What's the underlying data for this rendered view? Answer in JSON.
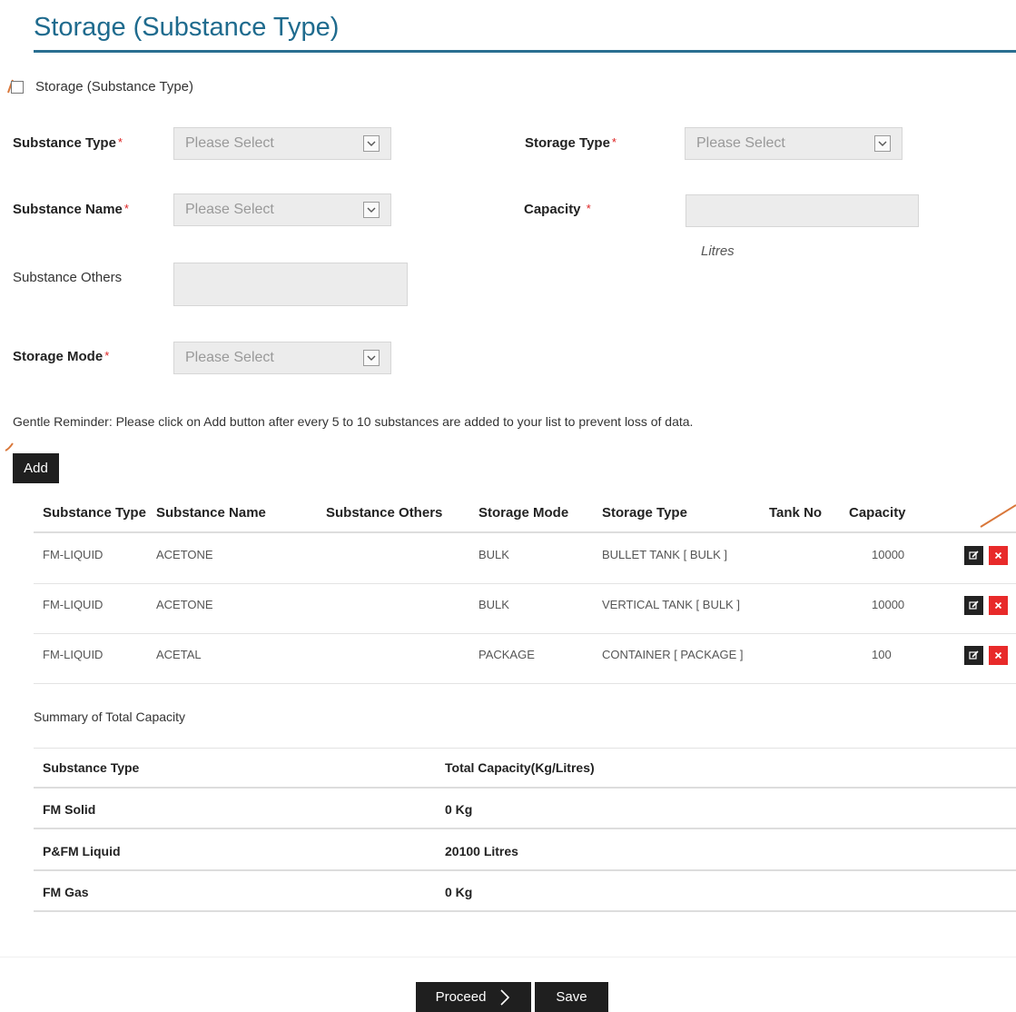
{
  "page": {
    "title": "Storage (Substance Type)"
  },
  "toggle": {
    "label": "Storage (Substance Type)"
  },
  "form": {
    "substance_type": {
      "label": "Substance Type",
      "required_mark": "*",
      "placeholder": "Please Select"
    },
    "storage_type": {
      "label": "Storage Type",
      "required_mark": "*",
      "placeholder": "Please Select"
    },
    "substance_name": {
      "label": "Substance Name",
      "required_mark": "*",
      "placeholder": "Please Select"
    },
    "capacity": {
      "label": "Capacity",
      "required_mark": "*",
      "value": "",
      "unit": "Litres"
    },
    "substance_others": {
      "label": "Substance Others",
      "value": ""
    },
    "storage_mode": {
      "label": "Storage Mode",
      "required_mark": "*",
      "placeholder": "Please Select"
    }
  },
  "reminder": "Gentle Reminder: Please click on Add button after every 5 to 10 substances are added to your list to prevent loss of data.",
  "add_button": "Add",
  "substance_table": {
    "columns": [
      "Substance Type",
      "Substance Name",
      "Substance Others",
      "Storage Mode",
      "Storage Type",
      "Tank No",
      "Capacity"
    ],
    "rows": [
      {
        "substance_type": "FM-LIQUID",
        "substance_name": "ACETONE",
        "substance_others": "",
        "storage_mode": "BULK",
        "storage_type": "BULLET TANK [ BULK ]",
        "tank_no": "",
        "capacity": "10000"
      },
      {
        "substance_type": "FM-LIQUID",
        "substance_name": "ACETONE",
        "substance_others": "",
        "storage_mode": "BULK",
        "storage_type": "VERTICAL TANK [ BULK ]",
        "tank_no": "",
        "capacity": "10000"
      },
      {
        "substance_type": "FM-LIQUID",
        "substance_name": "ACETAL",
        "substance_others": "",
        "storage_mode": "PACKAGE",
        "storage_type": "CONTAINER [ PACKAGE ]",
        "tank_no": "",
        "capacity": "100"
      }
    ],
    "icons": {
      "edit": "edit-icon",
      "delete": "delete-icon"
    },
    "colors": {
      "edit": "#222222",
      "delete": "#e82a2a"
    }
  },
  "summary": {
    "title": "Summary of Total Capacity",
    "columns": [
      "Substance Type",
      "Total Capacity(Kg/Litres)"
    ],
    "rows": [
      {
        "type": "FM Solid",
        "total": "0 Kg"
      },
      {
        "type": "P&FM Liquid",
        "total": "20100 Litres"
      },
      {
        "type": "FM Gas",
        "total": "0 Kg"
      }
    ]
  },
  "footer": {
    "proceed_label": "Proceed",
    "save_label": "Save"
  },
  "theme": {
    "accent": "#1f6b8e",
    "rule": "#2a6f91",
    "callout": "#d9773a",
    "required": "#dd2222"
  }
}
